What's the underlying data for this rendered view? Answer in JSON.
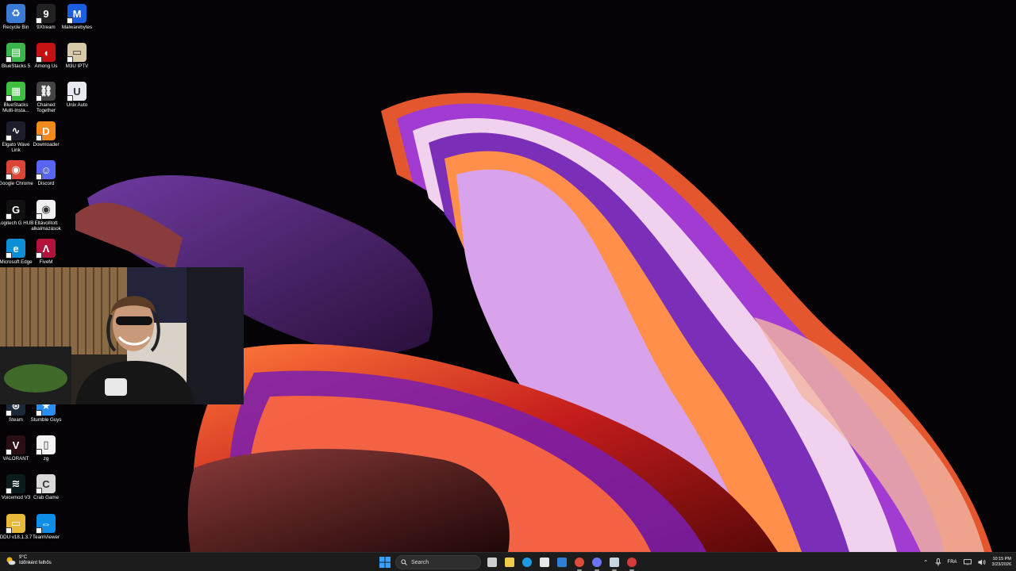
{
  "desktop": {
    "icons": [
      {
        "label": "Recycle Bin",
        "icon": "recycle-bin-icon",
        "color": "#3a7bd5",
        "glyph": "♻"
      },
      {
        "label": "9Xtream",
        "icon": "9xtream-icon",
        "color": "#222222",
        "glyph": "9"
      },
      {
        "label": "Malwarebytes",
        "icon": "malwarebytes-icon",
        "color": "#1b5fe0",
        "glyph": "M"
      },
      {
        "label": "BlueStacks 5",
        "icon": "bluestacks-icon",
        "color": "#3bb54a",
        "glyph": "▤"
      },
      {
        "label": "Among Us",
        "icon": "among-us-icon",
        "color": "#c51111",
        "glyph": "◖"
      },
      {
        "label": "M3U IPTV",
        "icon": "m3u-iptv-icon",
        "color": "#d8c9a8",
        "glyph": "▭"
      },
      {
        "label": "BlueStacks Multi-Insta...",
        "icon": "bluestacks-multi-icon",
        "color": "#3fbf3f",
        "glyph": "▦"
      },
      {
        "label": "Chained Together",
        "icon": "chained-together-icon",
        "color": "#444444",
        "glyph": "⛓"
      },
      {
        "label": "Unix Auto",
        "icon": "unix-auto-icon",
        "color": "#e8e8f0",
        "glyph": "U"
      },
      {
        "label": "Elgato Wave Link",
        "icon": "elgato-wave-link-icon",
        "color": "#1d1d2b",
        "glyph": "∿"
      },
      {
        "label": "Downloader",
        "icon": "downloader-icon",
        "color": "#f08a1c",
        "glyph": "D"
      },
      {
        "label": "Google Chrome",
        "icon": "chrome-icon",
        "color": "#db4437",
        "glyph": "◉"
      },
      {
        "label": "Discord",
        "icon": "discord-icon",
        "color": "#5865f2",
        "glyph": "☺"
      },
      {
        "label": "Logitech G HUB",
        "icon": "logitech-ghub-icon",
        "color": "#111111",
        "glyph": "G"
      },
      {
        "label": "Eltávolított alkalmazások",
        "icon": "removed-apps-icon",
        "color": "#f1f1f1",
        "glyph": "◉"
      },
      {
        "label": "Microsoft Edge",
        "icon": "edge-icon",
        "color": "#0c8fd6",
        "glyph": "e"
      },
      {
        "label": "FiveM",
        "icon": "fivem-icon",
        "color": "#b3123d",
        "glyph": "Λ"
      },
      {
        "label": "Steam",
        "icon": "steam-icon",
        "color": "#1b2838",
        "glyph": "⊛"
      },
      {
        "label": "Stumble Guys",
        "icon": "stumble-guys-icon",
        "color": "#2a8ef0",
        "glyph": "★"
      },
      {
        "label": "VALORANT",
        "icon": "valorant-icon",
        "color": "#2b0f14",
        "glyph": "V"
      },
      {
        "label": "zg",
        "icon": "file-icon",
        "color": "#f4f4f4",
        "glyph": "▯"
      },
      {
        "label": "Voicemod V3",
        "icon": "voicemod-icon",
        "color": "#0b1b1b",
        "glyph": "≋"
      },
      {
        "label": "Crab Game",
        "icon": "crab-game-icon",
        "color": "#d9d9d9",
        "glyph": "C"
      },
      {
        "label": "DDU v18.1.3.7",
        "icon": "folder-icon",
        "color": "#e8b93a",
        "glyph": "▭"
      },
      {
        "label": "TeamViewer",
        "icon": "teamviewer-icon",
        "color": "#0e8ee9",
        "glyph": "⇔"
      }
    ]
  },
  "taskbar": {
    "weather": {
      "temp": "9°C",
      "condition": "Időnként felhős"
    },
    "search": {
      "placeholder": "Search"
    },
    "apps": [
      {
        "name": "task-view",
        "icon": "task-view-icon",
        "color": "#cfcfcf",
        "active": false
      },
      {
        "name": "file-explorer",
        "icon": "file-explorer-icon",
        "color": "#f2c94c",
        "active": false
      },
      {
        "name": "edge",
        "icon": "edge-icon",
        "color": "#1e9be0",
        "active": false
      },
      {
        "name": "store",
        "icon": "store-icon",
        "color": "#e7e7e7",
        "active": false
      },
      {
        "name": "mail",
        "icon": "mail-icon",
        "color": "#2f7fd6",
        "active": false
      },
      {
        "name": "chrome",
        "icon": "chrome-icon",
        "color": "#e04a3a",
        "active": true
      },
      {
        "name": "discord",
        "icon": "discord-icon",
        "color": "#6a74f5",
        "active": true
      },
      {
        "name": "steam",
        "icon": "steam-icon",
        "color": "#c7d5e0",
        "active": true
      },
      {
        "name": "obs",
        "icon": "obs-icon",
        "color": "#d33b3b",
        "active": true
      }
    ],
    "tray": {
      "language": "FRA",
      "time": "10:15 PM",
      "date": "3/23/2026"
    }
  },
  "colors": {
    "taskbar_bg": "#1c1c1c",
    "desktop_bg": "#050306",
    "search_bg": "#2d2d2d"
  }
}
